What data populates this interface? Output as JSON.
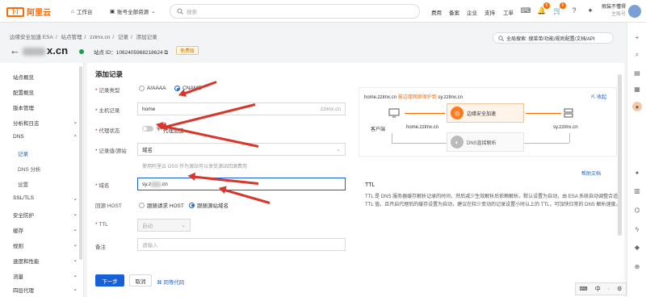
{
  "topbar": {
    "logo_text": "阿里云",
    "workbench": "工作台",
    "account": "账号全部资源",
    "search_placeholder": "搜索",
    "nav": [
      "费用",
      "备案",
      "企业",
      "支持",
      "工单"
    ],
    "badges": [
      "6",
      "6"
    ],
    "user_name": "假装不懂得",
    "user_sub": "主账号"
  },
  "breadcrumb": [
    "边缘安全加速 ESA",
    "/",
    "站点管理",
    "/",
    "zzlmx.cn",
    "/",
    "记录",
    "/",
    "添加记录"
  ],
  "header": {
    "back": "←",
    "domain_suffix": "x.cn",
    "site_id": "站点 ID：1062405968218624",
    "copy_icon": "⧉",
    "free_badge": "免费版",
    "global_search": "全局搜索: 搜菜单/功能/规则配置/文档/API"
  },
  "sidebar": {
    "items": [
      {
        "label": "站点概览",
        "chev": ""
      },
      {
        "label": "配置概览",
        "chev": ""
      },
      {
        "label": "版本管理",
        "chev": ""
      },
      {
        "label": "分析和日志",
        "chev": "⌄"
      },
      {
        "label": "DNS",
        "chev": "⌃"
      },
      {
        "label": "记录",
        "chev": ""
      },
      {
        "label": "DNS 分析",
        "chev": ""
      },
      {
        "label": "设置",
        "chev": ""
      },
      {
        "label": "SSL/TLS",
        "chev": "⌄"
      },
      {
        "label": "安全防护",
        "chev": "⌄"
      },
      {
        "label": "缓存",
        "chev": "⌄"
      },
      {
        "label": "规则",
        "chev": "⌄"
      },
      {
        "label": "速度和性能",
        "chev": "⌄"
      },
      {
        "label": "流量",
        "chev": "⌄"
      },
      {
        "label": "四层代理",
        "chev": "⌄"
      }
    ]
  },
  "form": {
    "title": "添加记录",
    "record_type_label": "记录类型",
    "opt_a": "A/AAAA",
    "opt_cname": "CNAME",
    "host_label": "主机记录",
    "host_value": "home",
    "host_suffix": "zzlmx.cn",
    "proxy_label": "代理状态",
    "proxy_text": "代理加速",
    "origin_type_label": "记录值/源站",
    "origin_type_value": "域名",
    "hint": "使用阿里云 OSS 作为源站可以享受源站回源费用",
    "domain_label": "域名",
    "domain_value_a": "sy.z",
    "domain_value_b": ".cn",
    "origin_host_label": "回源 HOST",
    "host_opt1": "跟随请求 HOST",
    "host_opt2": "跟随源站域名",
    "ttl_label": "TTL",
    "ttl_value": "自动",
    "note_label": "备注",
    "note_placeholder": "请输入",
    "next_button": "下一步",
    "cancel_button": "取消",
    "code_link": "同等代码",
    "req": "*"
  },
  "panel": {
    "path_a": "home.zzlmx.cn",
    "path_b": "被边缘网络保护到",
    "path_c": "sy.zzlmx.cn",
    "collapse": "收起",
    "client": "客户端",
    "client_domain": "home.zzlmx.cn",
    "esa": "边缘安全加速",
    "dns": "DNS直接解析",
    "target": "sy.zzlmx.cn"
  },
  "help": {
    "link": "帮助文档",
    "ttl_title": "TTL",
    "ttl_desc": "TTL 是 DNS 服务器缓存解析记录的时间，然后减少生效解析后依赖解析。默认设置为自动，由 ESA 系统自动调整合适 TTL 值，且开启代理后的缓存设置为自动，建议在较少变动的记录设置小时以上的 TTL，可加快日常的 DNS 解析速度。"
  },
  "ime": [
    "⌨",
    "中",
    "·",
    "⚙"
  ]
}
